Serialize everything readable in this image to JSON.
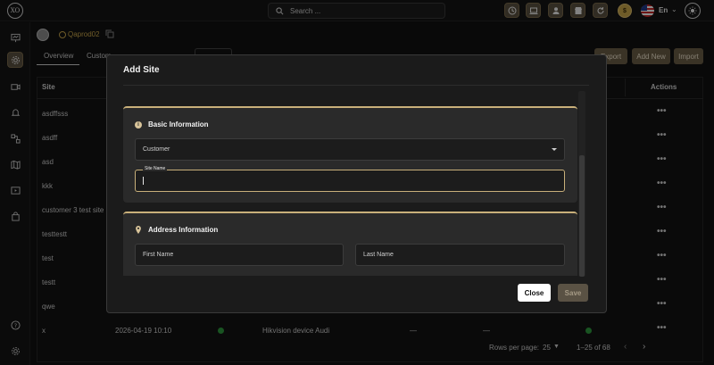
{
  "topbar": {
    "logo_text": "XO",
    "search_placeholder": "Search ...",
    "language": "En"
  },
  "breadcrumb": {
    "site_name": "Qaprod02"
  },
  "tabs": [
    "Overview",
    "Custom"
  ],
  "actions": {
    "export_label": "Export",
    "add_new_label": "Add New",
    "import_label": "Import"
  },
  "table": {
    "headers": {
      "site": "Site",
      "actions": "Actions"
    },
    "rows": [
      "asdffsss",
      "asdff",
      "asd",
      "kkk",
      "customer 3 test site",
      "testtestt",
      "test",
      "testt",
      "qwe",
      "x"
    ],
    "last_row": {
      "date": "2026-04-19 10:10",
      "device": "Hikvision device Audi",
      "dash1": "—",
      "dash2": "—"
    },
    "actions_glyph": "•••",
    "footer": {
      "rows_per_page_label": "Rows per page:",
      "rows_per_page_value": "25",
      "range": "1–25 of 68",
      "prev": "‹",
      "next": "›"
    }
  },
  "modal": {
    "title": "Add Site",
    "basic_section": {
      "title": "Basic Information",
      "customer_placeholder": "Customer",
      "site_name_label": "Site Name"
    },
    "address_section": {
      "title": "Address Information",
      "first_name_placeholder": "First Name",
      "last_name_placeholder": "Last Name"
    },
    "close_label": "Close",
    "save_label": "Save"
  },
  "colors": {
    "accent": "#c9b07a",
    "gold_button": "#6b5d45",
    "status_green": "#2e9a3e"
  }
}
